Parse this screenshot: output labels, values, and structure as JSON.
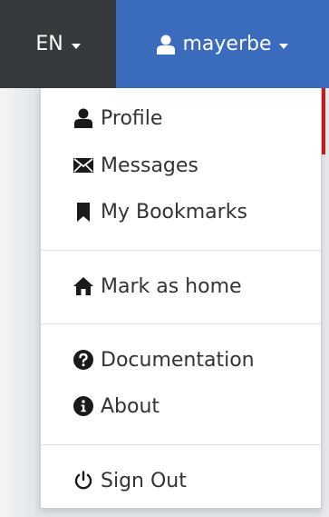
{
  "navbar": {
    "language_label": "EN",
    "username": "mayerbe"
  },
  "menu": {
    "profile": "Profile",
    "messages": "Messages",
    "bookmarks": "My Bookmarks",
    "mark_home": "Mark as home",
    "documentation": "Documentation",
    "about": "About",
    "sign_out": "Sign Out"
  },
  "colors": {
    "language_bg": "#373a3d",
    "user_bg": "#3b6bbd",
    "accent_red": "#d11a1a",
    "menu_text": "#333333",
    "icon": "#1a1a1a"
  },
  "icons": {
    "profile": "user-icon",
    "messages": "envelope-icon",
    "bookmarks": "bookmark-icon",
    "mark_home": "home-icon",
    "documentation": "question-circle-icon",
    "about": "info-circle-icon",
    "sign_out": "power-icon"
  }
}
